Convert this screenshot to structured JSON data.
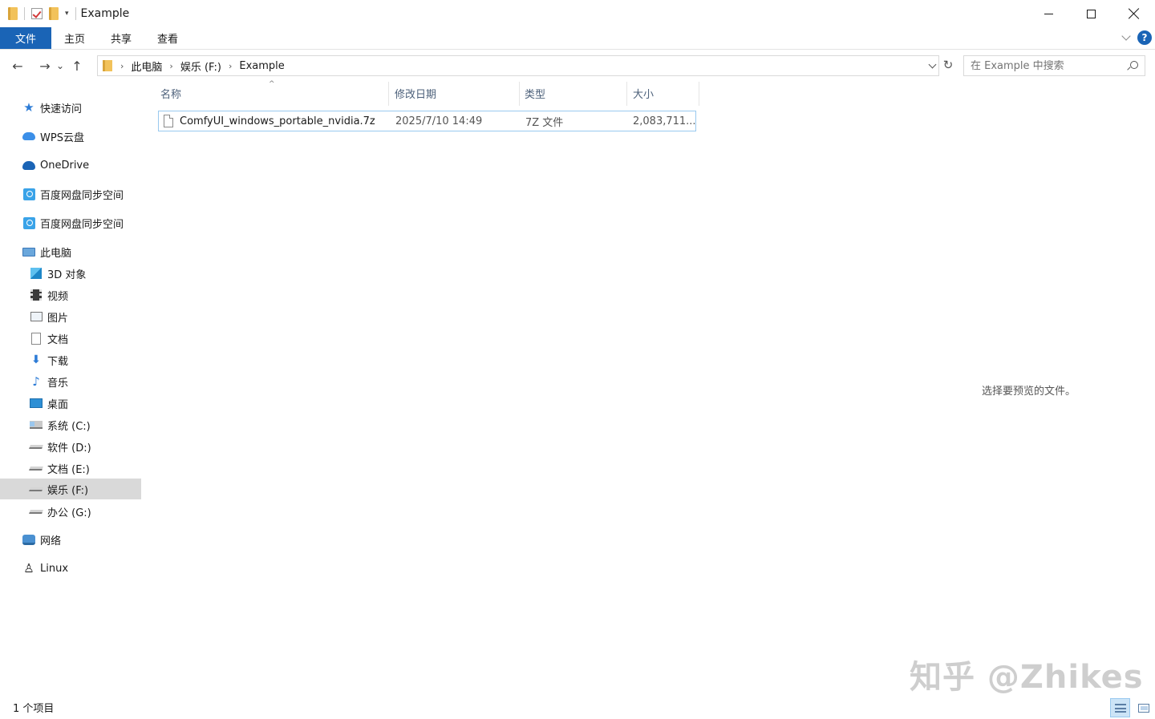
{
  "window": {
    "title": "Example"
  },
  "ribbon": {
    "tabs": [
      "文件",
      "主页",
      "共享",
      "查看"
    ],
    "help": "?"
  },
  "nav": {
    "back": "←",
    "forward": "→",
    "recent": "⌄",
    "up": "↑",
    "breadcrumb": [
      "此电脑",
      "娱乐 (F:)",
      "Example"
    ],
    "refresh": "↻",
    "search_placeholder": "在 Example 中搜索"
  },
  "sidebar": {
    "items": [
      {
        "label": "快速访问",
        "icon": "star-icon"
      },
      {
        "label": "WPS云盘",
        "icon": "wps-cloud-icon"
      },
      {
        "label": "OneDrive",
        "icon": "onedrive-icon"
      },
      {
        "label": "百度网盘同步空间",
        "icon": "baidu-netdisk-icon"
      },
      {
        "label": "百度网盘同步空间",
        "icon": "baidu-netdisk-icon"
      },
      {
        "label": "此电脑",
        "icon": "computer-icon"
      },
      {
        "label": "3D 对象",
        "icon": "cube-icon"
      },
      {
        "label": "视频",
        "icon": "video-icon"
      },
      {
        "label": "图片",
        "icon": "picture-icon"
      },
      {
        "label": "文档",
        "icon": "document-icon"
      },
      {
        "label": "下载",
        "icon": "download-icon"
      },
      {
        "label": "音乐",
        "icon": "music-icon"
      },
      {
        "label": "桌面",
        "icon": "desktop-icon"
      },
      {
        "label": "系统 (C:)",
        "icon": "system-drive-icon"
      },
      {
        "label": "软件 (D:)",
        "icon": "drive-icon"
      },
      {
        "label": "文档 (E:)",
        "icon": "drive-icon"
      },
      {
        "label": "娱乐 (F:)",
        "icon": "drive-icon"
      },
      {
        "label": "办公 (G:)",
        "icon": "drive-icon"
      },
      {
        "label": "网络",
        "icon": "network-icon"
      },
      {
        "label": "Linux",
        "icon": "linux-penguin-icon"
      }
    ],
    "selected": "娱乐 (F:)"
  },
  "filelist": {
    "columns": [
      "名称",
      "修改日期",
      "类型",
      "大小"
    ],
    "sort_glyph": "^",
    "rows": [
      {
        "name": "ComfyUI_windows_portable_nvidia.7z",
        "modified": "2025/7/10 14:49",
        "type": "7Z 文件",
        "size": "2,083,711..."
      }
    ]
  },
  "preview": {
    "hint": "选择要预览的文件。"
  },
  "status": {
    "count": "1 个项目"
  },
  "watermark": "知乎 @Zhikes",
  "colors": {
    "accent": "#1a64b6",
    "selection": "#d9d9d9",
    "row_border": "#99c9ef"
  }
}
